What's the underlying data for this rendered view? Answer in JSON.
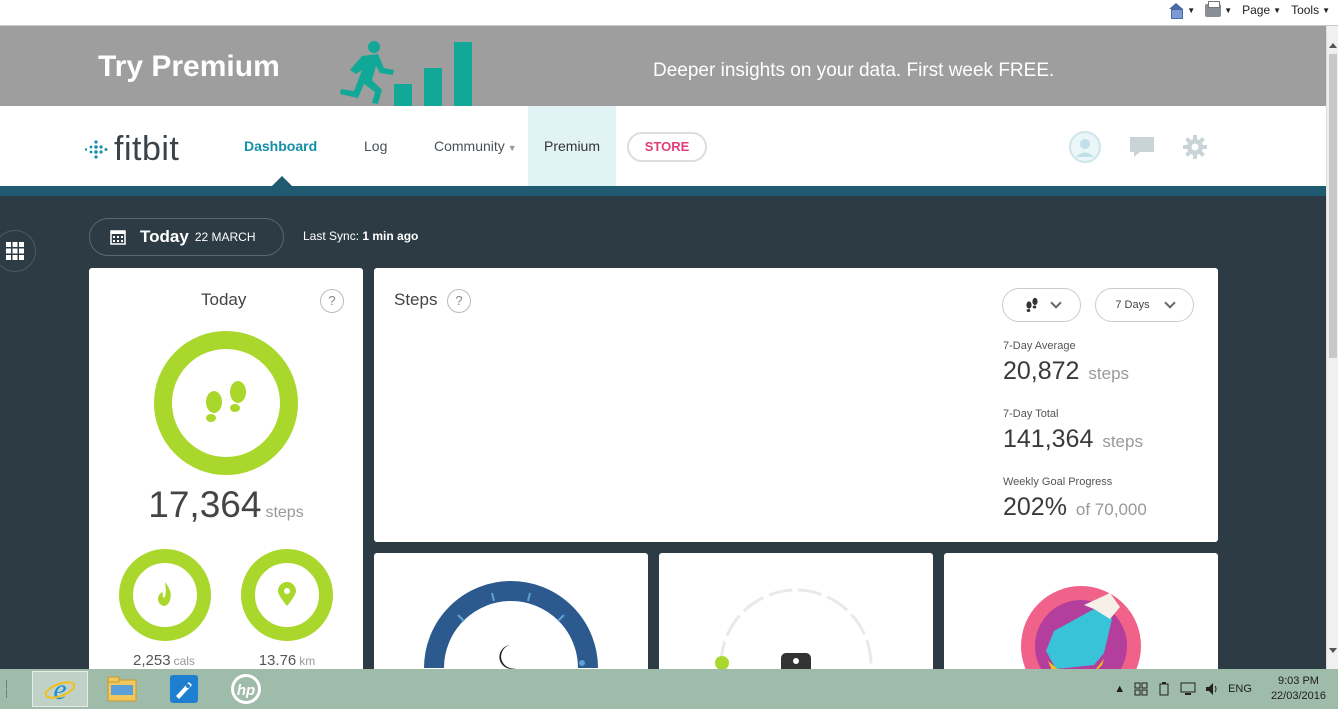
{
  "browser": {
    "commands": {
      "page": "Page",
      "tools": "Tools"
    },
    "icons": [
      "home-icon",
      "print-icon"
    ]
  },
  "banner": {
    "title": "Try Premium",
    "tagline": "Deeper insights on your data. First week FREE.",
    "colors": {
      "bg": "#9e9e9e",
      "accent": "#12a898"
    }
  },
  "nav": {
    "logo": "fitbit",
    "items": [
      {
        "label": "Dashboard"
      },
      {
        "label": "Log"
      },
      {
        "label": "Community"
      },
      {
        "label": "Premium"
      }
    ],
    "store": "STORE",
    "colors": {
      "active": "#138fa8",
      "store": "#e43e7a",
      "bar": "#1f5a70"
    }
  },
  "header": {
    "date_title": "Today",
    "date": "22 MARCH",
    "sync_label": "Last Sync:",
    "sync_value": "1 min ago"
  },
  "today_card": {
    "title": "Today",
    "help": "?",
    "steps_value": "17,364",
    "steps_unit": "steps",
    "cals_value": "2,253",
    "cals_unit": "cals",
    "km_value": "13.76",
    "km_unit": "km",
    "ring_color": "#a9d72c"
  },
  "steps_card": {
    "title": "Steps",
    "help": "?",
    "range": "7 Days",
    "avg_label": "7-Day Average",
    "avg_value": "20,872",
    "avg_unit": "steps",
    "total_label": "7-Day Total",
    "total_value": "141,364",
    "total_unit": "steps",
    "goal_label": "Weekly Goal Progress",
    "goal_value": "202%",
    "goal_target": "of 70,000"
  },
  "taskbar": {
    "lang": "ENG",
    "time": "9:03 PM",
    "date": "22/03/2016"
  }
}
